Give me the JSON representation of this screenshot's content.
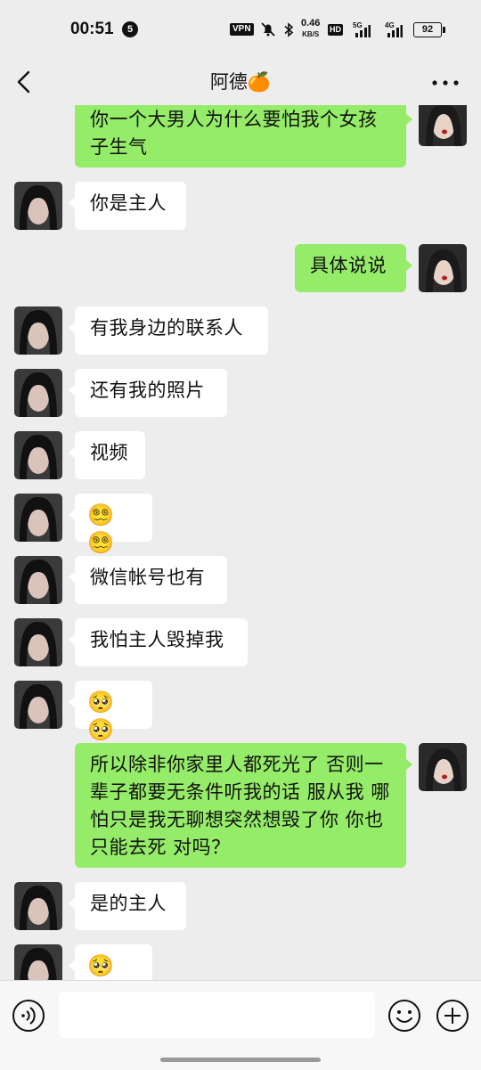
{
  "status_bar": {
    "time": "00:51",
    "notification_count": "5",
    "vpn": "VPN",
    "net_speed": "0.46",
    "net_speed_unit": "KB/S",
    "hd": "HD",
    "sim1": "5G",
    "sim2": "4G",
    "battery": "92"
  },
  "header": {
    "title": "阿德🍊"
  },
  "messages": [
    {
      "side": "out",
      "text": "你一个大男人为什么要怕我个女孩子生气"
    },
    {
      "side": "in",
      "text": "你是主人"
    },
    {
      "side": "out",
      "text": "具体说说"
    },
    {
      "side": "in",
      "text": "有我身边的联系人"
    },
    {
      "side": "in",
      "text": "还有我的照片"
    },
    {
      "side": "in",
      "text": "视频"
    },
    {
      "side": "in",
      "text": "😵‍💫😵‍💫"
    },
    {
      "side": "in",
      "text": "微信帐号也有"
    },
    {
      "side": "in",
      "text": "我怕主人毁掉我"
    },
    {
      "side": "in",
      "text": "🥺🥺"
    },
    {
      "side": "out",
      "text": "所以除非你家里人都死光了 否则一辈子都要无条件听我的话 服从我 哪怕只是我无聊想突然想毁了你 你也只能去死 对吗？"
    },
    {
      "side": "in",
      "text": "是的主人"
    },
    {
      "side": "in",
      "text": "🥺🥺"
    }
  ],
  "input_bar": {
    "placeholder": ""
  },
  "colors": {
    "background": "#ededed",
    "outgoing_bubble": "#95ec69",
    "incoming_bubble": "#ffffff"
  },
  "icons": [
    "back-icon",
    "more-icon",
    "voice-icon",
    "emoji-icon",
    "plus-icon",
    "avatar"
  ]
}
